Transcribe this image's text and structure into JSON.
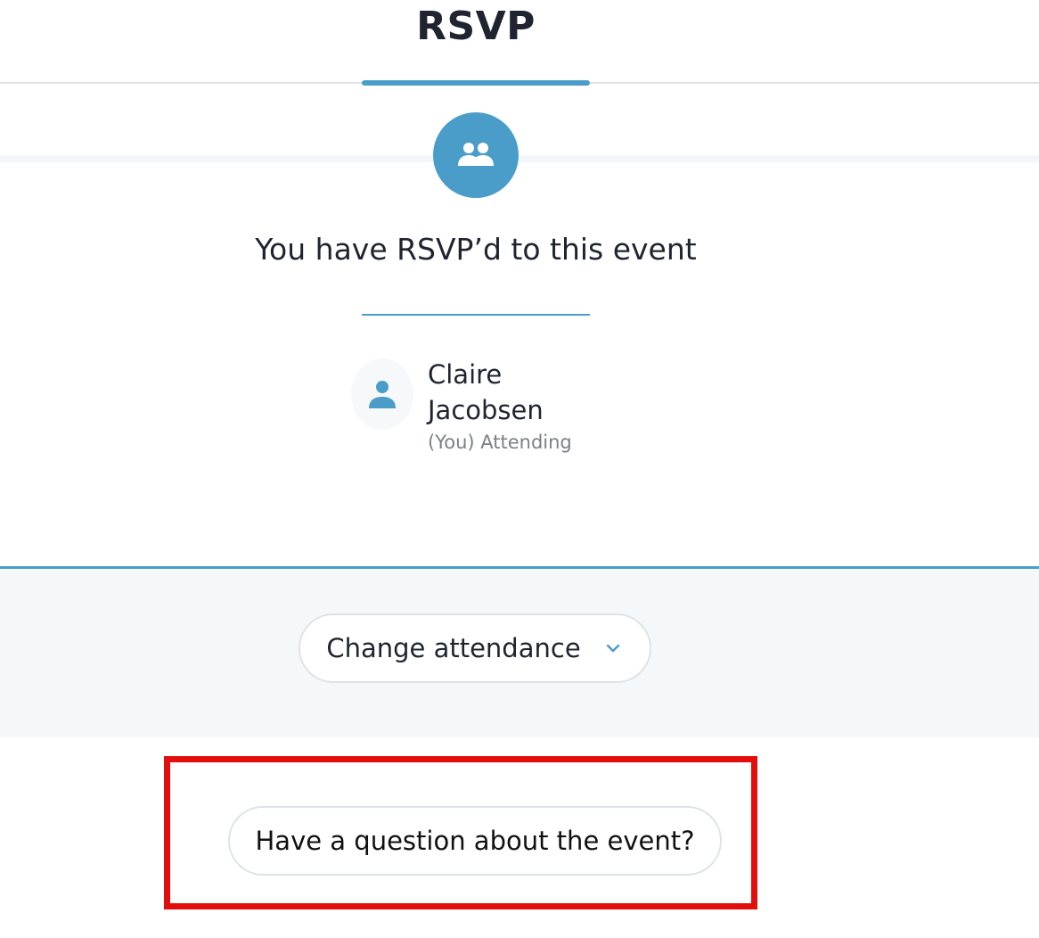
{
  "tabs": {
    "active_label": "RSVP"
  },
  "rsvp": {
    "status_text": "You have RSVP’d to this event",
    "group_icon": "people-icon"
  },
  "attendee": {
    "first_name": "Claire",
    "last_name": "Jacobsen",
    "status": "(You) Attending",
    "avatar_icon": "person-icon"
  },
  "actions": {
    "change_attendance_label": "Change attendance",
    "question_label": "Have a question about the event?"
  },
  "colors": {
    "accent": "#4a9dc9",
    "highlight": "#e20d0d"
  }
}
